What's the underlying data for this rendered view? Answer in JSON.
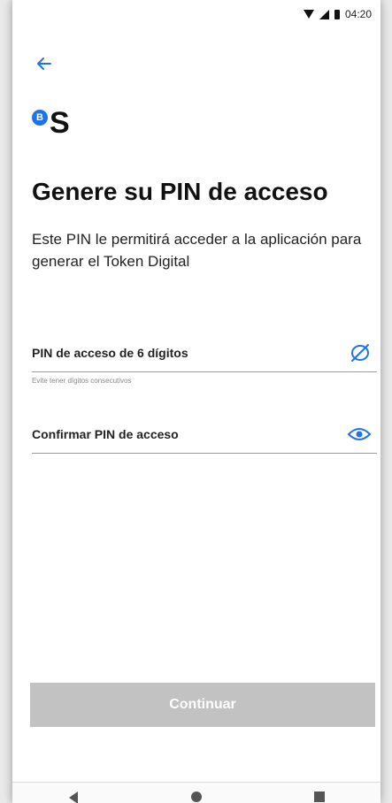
{
  "status_bar": {
    "time": "04:20",
    "icons": [
      "wifi-icon",
      "signal-icon",
      "battery-icon"
    ]
  },
  "header": {
    "back_icon": "arrow-left-icon"
  },
  "logo": {
    "badge": "B",
    "letter": "S",
    "badge_color": "#1e73e8"
  },
  "main": {
    "title": "Genere su PIN de acceso",
    "subtitle": "Este PIN le permitirá acceder a la aplicación para generar el Token Digital"
  },
  "form": {
    "pin_label": "PIN de acceso de 6 dígitos",
    "pin_icon": "eye-off-icon",
    "pin_helper": "Evite tener dígitos consecutivos",
    "confirm_label": "Confirmar PIN de acceso",
    "confirm_icon": "eye-icon"
  },
  "footer": {
    "continue_label": "Continuar",
    "continue_enabled": false
  },
  "nav": {
    "icons": [
      "nav-back-icon",
      "nav-home-icon",
      "nav-recent-icon"
    ]
  },
  "colors": {
    "accent": "#1e73e8",
    "button_disabled": "#c2c2c2"
  }
}
